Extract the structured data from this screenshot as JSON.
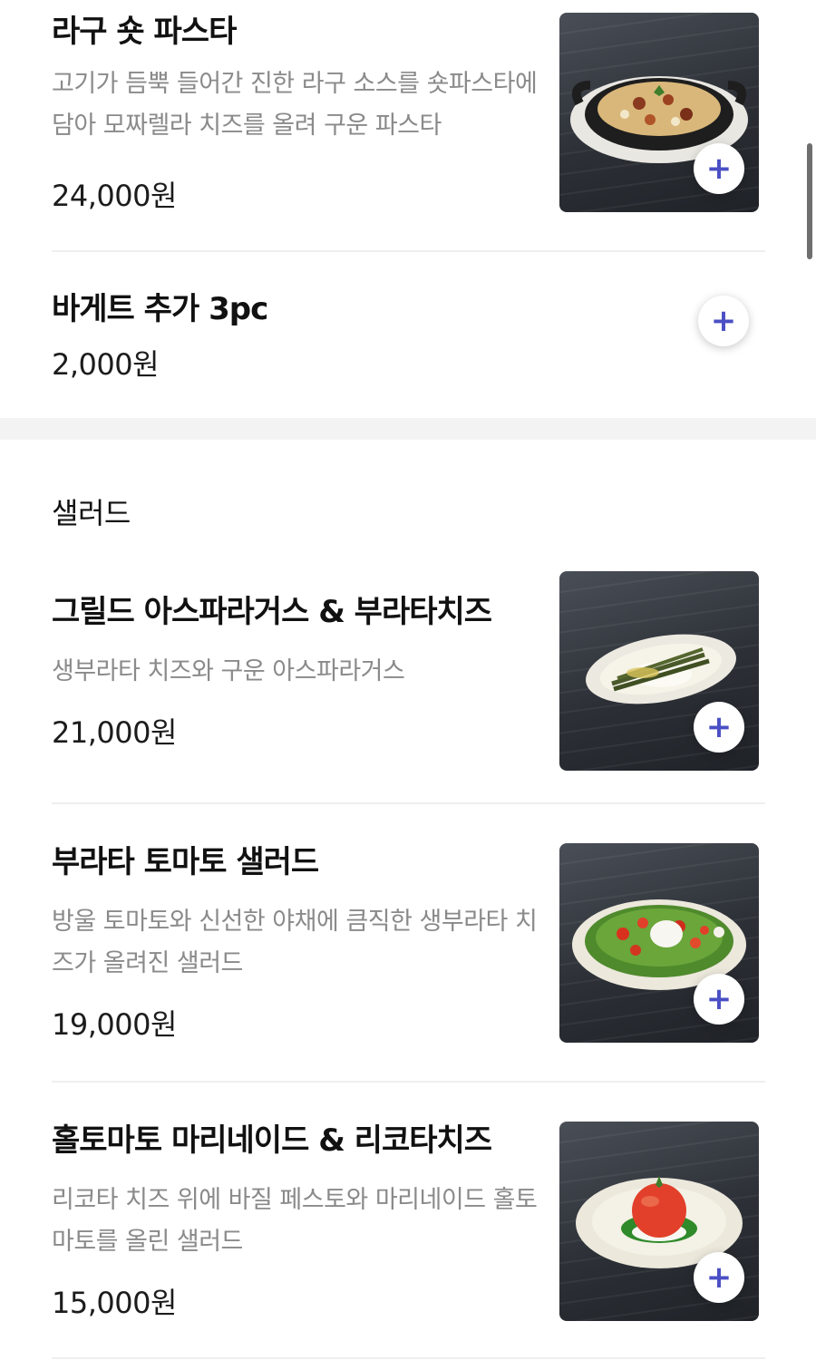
{
  "sections": [
    {
      "title": "",
      "items": [
        {
          "name": "라구 숏 파스타",
          "description": "고기가 듬뿍 들어간 진한 라구 소스를 숏파스타에 담아 모짜렐라 치즈를 올려 구운 파스타",
          "price": "24,000원",
          "has_image": true,
          "image": "ragu-short-pasta-photo"
        },
        {
          "name": "바게트 추가 3pc",
          "description": "",
          "price": "2,000원",
          "has_image": false
        }
      ]
    },
    {
      "title": "샐러드",
      "items": [
        {
          "name": "그릴드 아스파라거스 & 부라타치즈",
          "description": "생부라타 치즈와 구운 아스파라거스",
          "price": "21,000원",
          "has_image": true,
          "image": "asparagus-burrata-photo"
        },
        {
          "name": "부라타 토마토 샐러드",
          "description": "방울 토마토와 신선한 야채에 큼직한 생부라타 치즈가 올려진 샐러드",
          "price": "19,000원",
          "has_image": true,
          "image": "burrata-tomato-salad-photo"
        },
        {
          "name": "홀토마토 마리네이드 & 리코타치즈",
          "description": "리코타 치즈 위에 바질 페스토와 마리네이드 홀토마토를 올린 샐러드",
          "price": "15,000원",
          "has_image": true,
          "image": "whole-tomato-ricotta-photo"
        }
      ]
    }
  ],
  "add_button_symbol": "+",
  "colors": {
    "accent": "#4b4fc4",
    "description_text": "#8a8a8a",
    "divider": "#efefef",
    "section_gap": "#f3f3f3"
  },
  "icons": [
    "plus-icon"
  ]
}
